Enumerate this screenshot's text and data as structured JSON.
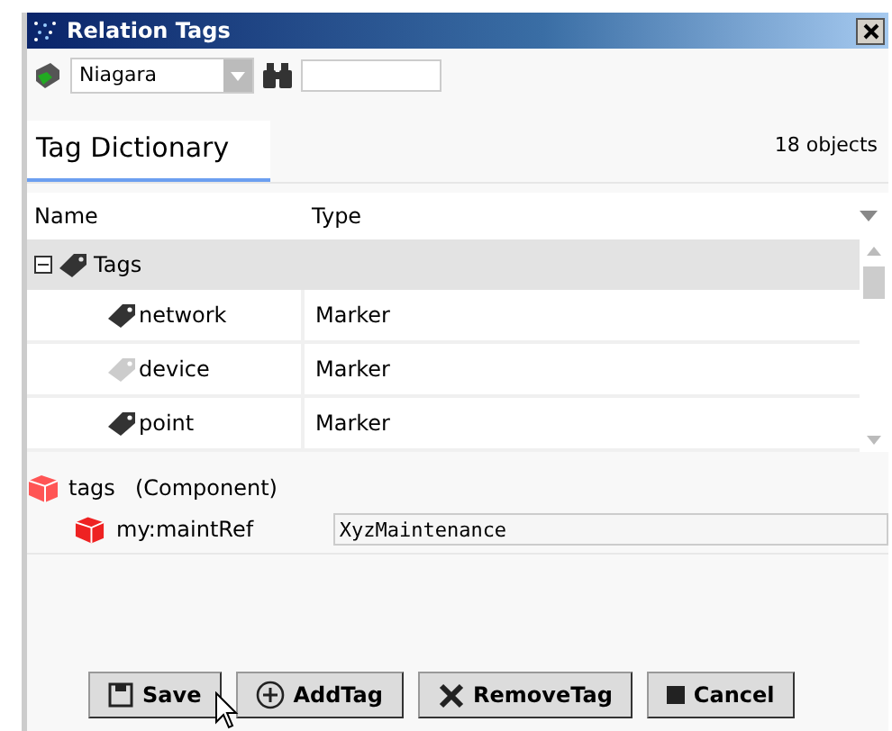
{
  "window": {
    "title": "Relation Tags"
  },
  "toolbar": {
    "namespace": "Niagara"
  },
  "tab": {
    "label": "Tag Dictionary",
    "selected": true
  },
  "object_count": "18 objects",
  "table": {
    "columns": [
      "Name",
      "Type"
    ],
    "tree": [
      {
        "name": "Tags",
        "expanded": true,
        "children": [
          {
            "name": "network",
            "type": "Marker",
            "enabled": true
          },
          {
            "name": "device",
            "type": "Marker",
            "enabled": false
          },
          {
            "name": "point",
            "type": "Marker",
            "enabled": true
          }
        ]
      }
    ]
  },
  "component": {
    "name": "tags",
    "type": "(Component)",
    "slots": [
      {
        "name": "my:maintRef",
        "value": "XyzMaintenance"
      }
    ]
  },
  "buttons": [
    {
      "label": "Save",
      "kind": "save"
    },
    {
      "label": "AddTag",
      "kind": "add"
    },
    {
      "label": "RemoveTag",
      "kind": "remove"
    },
    {
      "label": "Cancel",
      "kind": "stop"
    }
  ]
}
